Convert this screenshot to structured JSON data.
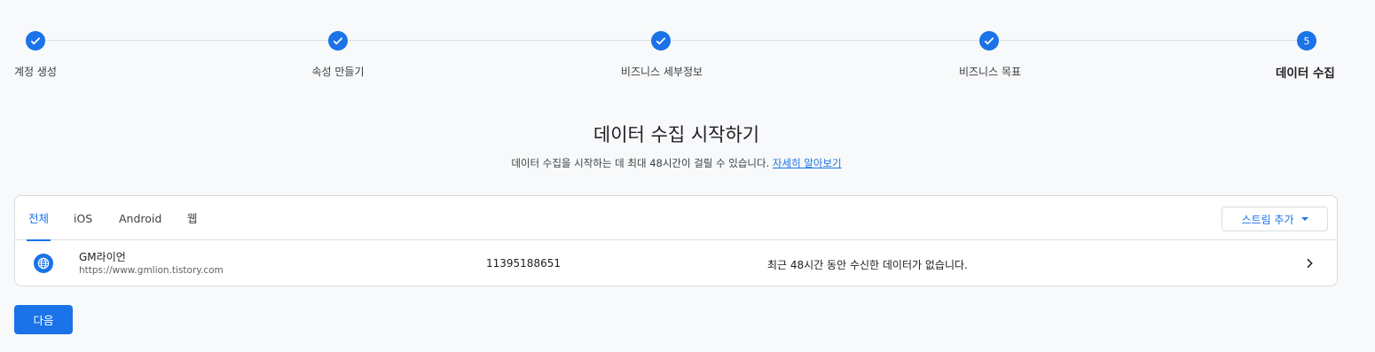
{
  "stepper": {
    "steps": [
      {
        "label": "계정 생성",
        "state": "done"
      },
      {
        "label": "속성 만들기",
        "state": "done"
      },
      {
        "label": "비즈니스 세부정보",
        "state": "done"
      },
      {
        "label": "비즈니스 목표",
        "state": "done"
      },
      {
        "label": "데이터 수집",
        "state": "current",
        "number": "5"
      }
    ]
  },
  "main": {
    "title": "데이터 수집 시작하기",
    "subtitle": "데이터 수집을 시작하는 데 최대 48시간이 걸릴 수 있습니다.",
    "learn_more": "자세히 알아보기"
  },
  "tabs": [
    "전체",
    "iOS",
    "Android",
    "웹"
  ],
  "add_stream_label": "스트림 추가",
  "streams": [
    {
      "icon": "globe-icon",
      "name": "GM라이언",
      "url": "https://www.gmlion.tistory.com",
      "id": "11395188651",
      "status": "최근 48시간 동안 수신한 데이터가 없습니다."
    }
  ],
  "next_label": "다음",
  "colors": {
    "accent": "#1a73e8",
    "border": "#dadce0",
    "background": "#f8f9fa"
  }
}
